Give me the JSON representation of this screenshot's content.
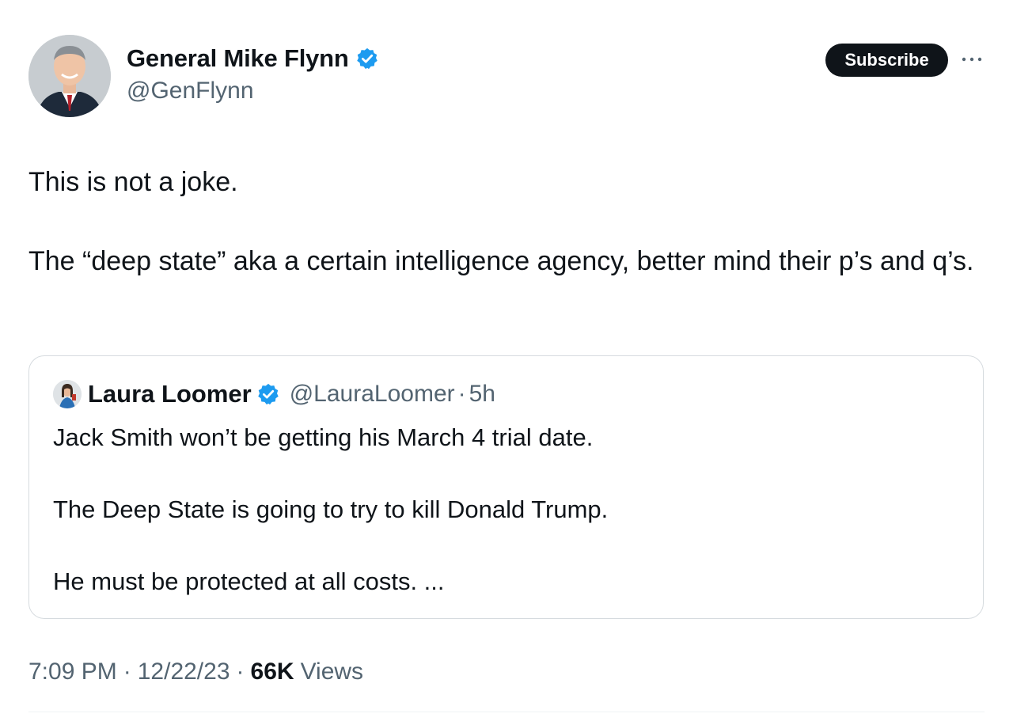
{
  "author": {
    "display_name": "General Mike Flynn",
    "handle": "@GenFlynn",
    "verified_icon": "verified-badge-icon"
  },
  "subscribe": {
    "label": "Subscribe"
  },
  "more_icon": "more-options-icon",
  "tweet": {
    "paragraphs": [
      "This is not a joke.",
      "The “deep state” aka a certain intelligence agency, better mind their p’s and q’s."
    ]
  },
  "quote": {
    "display_name": "Laura Loomer",
    "handle": "@LauraLoomer",
    "separator": "·",
    "time": "5h",
    "paragraphs": [
      "Jack Smith won’t be getting his March 4 trial date.",
      "The Deep State is going to try to kill Donald Trump.",
      "He must be protected at all costs. ..."
    ]
  },
  "meta": {
    "time": "7:09 PM",
    "separator": "·",
    "date": "12/22/23",
    "views_count": "66K",
    "views_label": "Views"
  },
  "colors": {
    "text_primary": "#0f1419",
    "text_secondary": "#536471",
    "verified_blue": "#1d9bf0",
    "border": "#d6dbdf",
    "button_bg": "#0f1419"
  }
}
